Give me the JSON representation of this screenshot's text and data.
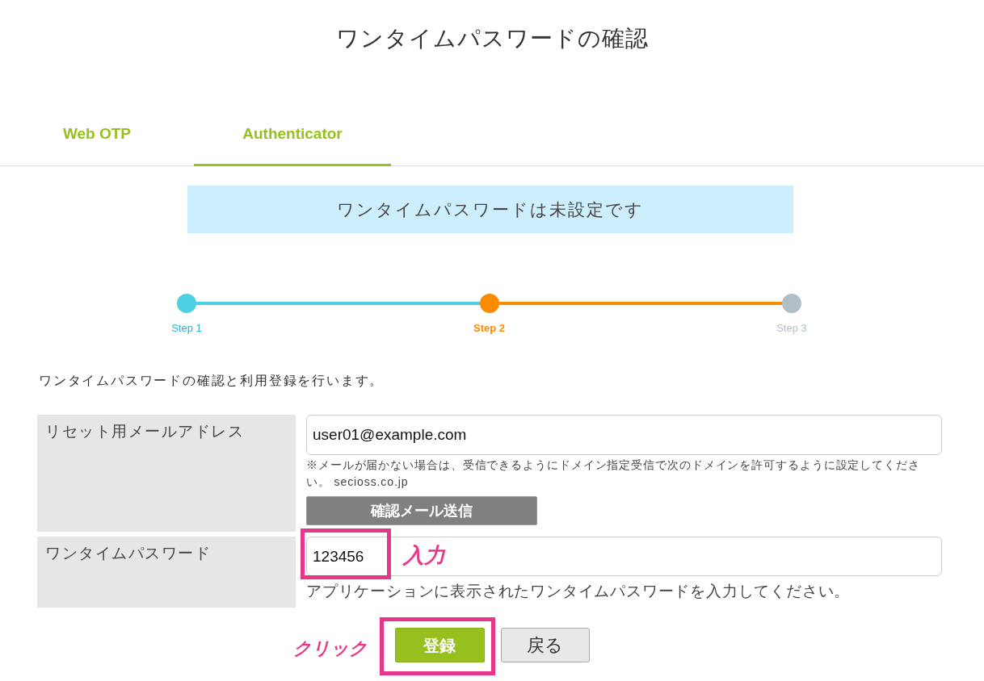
{
  "page": {
    "title": "ワンタイムパスワードの確認"
  },
  "tabs": [
    {
      "label": "Web OTP",
      "selected": false
    },
    {
      "label": "Authenticator",
      "selected": true
    }
  ],
  "notice": "ワンタイムパスワードは未設定です",
  "steps": [
    {
      "label": "Step 1",
      "selected": false
    },
    {
      "label": "Step 2",
      "selected": true
    },
    {
      "label": "Step 3",
      "selected": false
    }
  ],
  "intro": "ワンタイムパスワードの確認と利用登録を行います。",
  "form": {
    "rows": [
      {
        "kind": "email",
        "label": "リセット用メールアドレス",
        "value": "user01@example.com",
        "note": "※メールが届かない場合は、受信できるようにドメイン指定受信で次のドメインを許可するように設定してください。 secioss.co.jp",
        "button": "確認メール送信"
      },
      {
        "kind": "otp",
        "label": "ワンタイムパスワード",
        "value": "123456",
        "hint": "アプリケーションに表示されたワンタイムパスワードを入力してください。",
        "callout": "入力"
      }
    ]
  },
  "buttons": [
    {
      "label": "登録",
      "kind": "primary",
      "callout": "クリック"
    },
    {
      "label": "戻る",
      "kind": "secondary"
    }
  ]
}
